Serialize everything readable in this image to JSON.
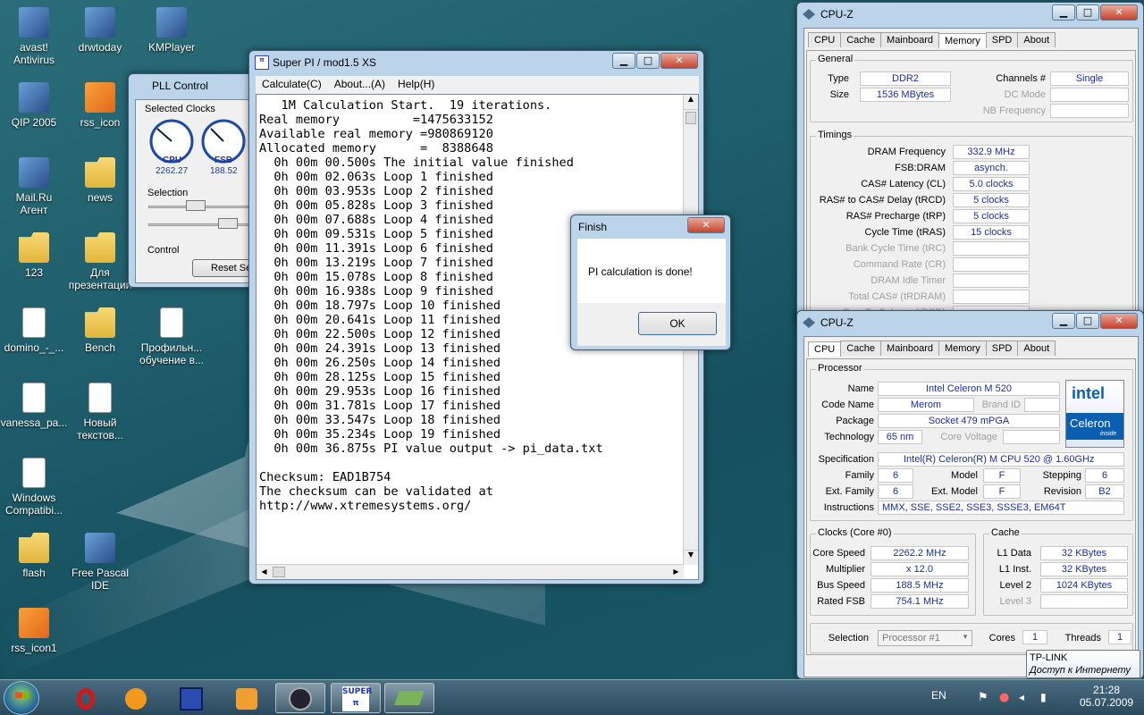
{
  "desktop": {
    "icons": [
      {
        "label": "avast!\nAntivirus",
        "icon": "avast-icon"
      },
      {
        "label": "drwtoday",
        "icon": "winrar-icon"
      },
      {
        "label": "KMPlayer",
        "icon": "kmplayer-icon"
      },
      {
        "label": "QIP 2005",
        "icon": "qip-icon"
      },
      {
        "label": "rss_icon",
        "icon": "rss-icon"
      },
      {
        "label": "Mail.Ru\nАгент",
        "icon": "mailru-icon"
      },
      {
        "label": "news",
        "icon": "folder-icon"
      },
      {
        "label": "123",
        "icon": "folder-icon"
      },
      {
        "label": "Для\nпрезентации",
        "icon": "folder-icon"
      },
      {
        "label": "domino_-_...",
        "icon": "document-icon"
      },
      {
        "label": "Bench",
        "icon": "folder-icon"
      },
      {
        "label": "Профильн...\nобучение в...",
        "icon": "word-doc-icon"
      },
      {
        "label": "vanessa_pa...",
        "icon": "document-icon"
      },
      {
        "label": "Новый\nтекстов...",
        "icon": "text-doc-icon"
      },
      {
        "label": "Windows\nCompatibi...",
        "icon": "opera-doc-icon"
      },
      {
        "label": "flash",
        "icon": "folder-icon"
      },
      {
        "label": "Free Pascal\nIDE",
        "icon": "freepascal-icon"
      },
      {
        "label": "rss_icon1",
        "icon": "rss-icon"
      }
    ]
  },
  "pll": {
    "title": "PLL Control",
    "selected_clocks": "Selected Clocks",
    "cpu_label": "CPU",
    "cpu_value": "2262.27",
    "fsb_label": "FSB",
    "fsb_value": "188.52",
    "selection": "Selection",
    "control": "Control",
    "reset": "Reset Se"
  },
  "superpi": {
    "title": "Super PI / mod1.5 XS",
    "menu": [
      "Calculate(C)",
      "About...(A)",
      "Help(H)"
    ],
    "lines": [
      "   1M Calculation Start.  19 iterations.",
      "Real memory          =1475633152",
      "Available real memory =980869120",
      "Allocated memory      =  8388648",
      "  0h 00m 00.500s The initial value finished",
      "  0h 00m 02.063s Loop 1 finished",
      "  0h 00m 03.953s Loop 2 finished",
      "  0h 00m 05.828s Loop 3 finished",
      "  0h 00m 07.688s Loop 4 finished",
      "  0h 00m 09.531s Loop 5 finished",
      "  0h 00m 11.391s Loop 6 finished",
      "  0h 00m 13.219s Loop 7 finished",
      "  0h 00m 15.078s Loop 8 finished",
      "  0h 00m 16.938s Loop 9 finished",
      "  0h 00m 18.797s Loop 10 finished",
      "  0h 00m 20.641s Loop 11 finished",
      "  0h 00m 22.500s Loop 12 finished",
      "  0h 00m 24.391s Loop 13 finished",
      "  0h 00m 26.250s Loop 14 finished",
      "  0h 00m 28.125s Loop 15 finished",
      "  0h 00m 29.953s Loop 16 finished",
      "  0h 00m 31.781s Loop 17 finished",
      "  0h 00m 33.547s Loop 18 finished",
      "  0h 00m 35.234s Loop 19 finished",
      "  0h 00m 36.875s PI value output -> pi_data.txt",
      "",
      "Checksum: EAD1B754",
      "The checksum can be validated at",
      "http://www.xtremesystems.org/"
    ]
  },
  "finish": {
    "title": "Finish",
    "message": "PI calculation is done!",
    "ok": "OK"
  },
  "cpuz_mem": {
    "title": "CPU-Z",
    "tabs": [
      "CPU",
      "Cache",
      "Mainboard",
      "Memory",
      "SPD",
      "About"
    ],
    "general": "General",
    "type_l": "Type",
    "type_v": "DDR2",
    "size_l": "Size",
    "size_v": "1536 MBytes",
    "channels_l": "Channels #",
    "channels_v": "Single",
    "dcmode_l": "DC Mode",
    "nbfreq_l": "NB Frequency",
    "timings": "Timings",
    "rows": [
      {
        "l": "DRAM Frequency",
        "v": "332.9 MHz"
      },
      {
        "l": "FSB:DRAM",
        "v": "asynch."
      },
      {
        "l": "CAS# Latency (CL)",
        "v": "5.0 clocks"
      },
      {
        "l": "RAS# to CAS# Delay (tRCD)",
        "v": "5 clocks"
      },
      {
        "l": "RAS# Precharge (tRP)",
        "v": "5 clocks"
      },
      {
        "l": "Cycle Time (tRAS)",
        "v": "15 clocks"
      },
      {
        "l": "Bank Cycle Time (tRC)",
        "v": ""
      },
      {
        "l": "Command Rate (CR)",
        "v": ""
      },
      {
        "l": "DRAM Idle Timer",
        "v": ""
      },
      {
        "l": "Total CAS# (tRDRAM)",
        "v": ""
      },
      {
        "l": "Row To Column (tRCD)",
        "v": ""
      }
    ]
  },
  "cpuz_cpu": {
    "title": "CPU-Z",
    "tabs": [
      "CPU",
      "Cache",
      "Mainboard",
      "Memory",
      "SPD",
      "About"
    ],
    "processor": "Processor",
    "name_l": "Name",
    "name_v": "Intel Celeron M 520",
    "code_l": "Code Name",
    "code_v": "Merom",
    "brand_l": "Brand ID",
    "package_l": "Package",
    "package_v": "Socket 479 mPGA",
    "tech_l": "Technology",
    "tech_v": "65 nm",
    "cvolt_l": "Core Voltage",
    "spec_l": "Specification",
    "spec_v": "Intel(R) Celeron(R) M CPU        520  @ 1.60GHz",
    "family_l": "Family",
    "family_v": "6",
    "model_l": "Model",
    "model_v": "F",
    "stepping_l": "Stepping",
    "stepping_v": "6",
    "extfam_l": "Ext. Family",
    "extfam_v": "6",
    "extmod_l": "Ext. Model",
    "extmod_v": "F",
    "rev_l": "Revision",
    "rev_v": "B2",
    "instr_l": "Instructions",
    "instr_v": "MMX, SSE, SSE2, SSE3, SSSE3, EM64T",
    "logo_top": "intel",
    "logo_bottom": "Celeron",
    "logo_sub": "inside",
    "clocks": "Clocks (Core #0)",
    "cs_l": "Core Speed",
    "cs_v": "2262.2 MHz",
    "mult_l": "Multiplier",
    "mult_v": "x 12.0",
    "bus_l": "Bus Speed",
    "bus_v": "188.5 MHz",
    "rfsb_l": "Rated FSB",
    "rfsb_v": "754.1 MHz",
    "cache": "Cache",
    "l1d_l": "L1 Data",
    "l1d_v": "32 KBytes",
    "l1i_l": "L1 Inst.",
    "l1i_v": "32 KBytes",
    "l2_l": "Level 2",
    "l2_v": "1024 KBytes",
    "l3_l": "Level 3",
    "sel_l": "Selection",
    "sel_v": "Processor #1",
    "cores_l": "Cores",
    "cores_v": "1",
    "threads_l": "Threads",
    "threads_v": "1"
  },
  "tooltip": {
    "line1": "TP-LINK",
    "line2": "Доступ к Интернету"
  },
  "taskbar": {
    "lang": "EN",
    "time": "21:28",
    "date": "05.07.2009"
  }
}
